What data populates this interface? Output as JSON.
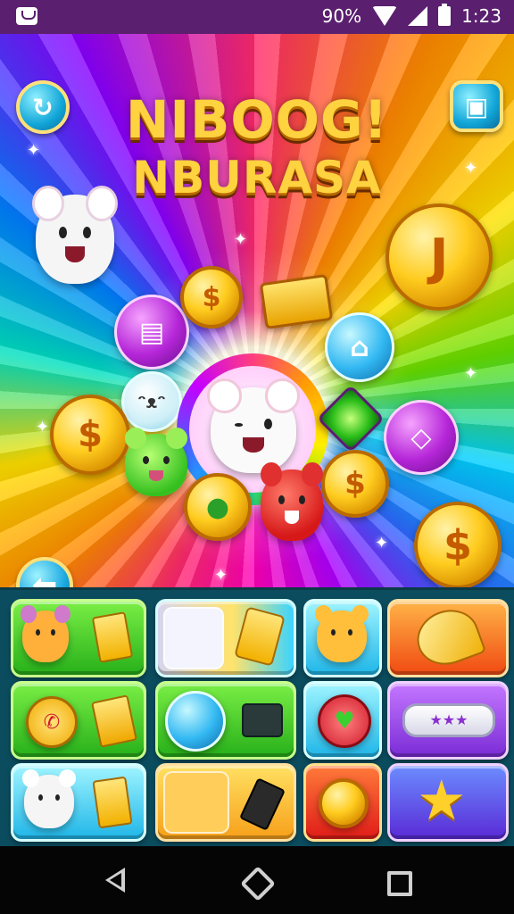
{
  "status_bar": {
    "battery_text": "90%",
    "time": "1:23"
  },
  "game": {
    "title_line1": "NIBOOG!",
    "title_line2": "NBURASA",
    "top_left_button_icon": "refresh-icon",
    "top_right_button_icon": "chat-bubble-icon",
    "back_button_icon": "arrow-left-icon",
    "coin_symbol": "$",
    "special_coin_symbol": "J"
  },
  "bottom_panel": {
    "rows": [
      [
        "green-creature-bar",
        "white-creature-card",
        "orange-creature",
        "orange-sparkle"
      ],
      [
        "green-phone-chair",
        "teal-globe-case",
        "blue-alarm-heart",
        "purple-stars-pill"
      ],
      [
        "blue-white-creature",
        "orange-tiger-card",
        "red-gold-coin",
        "purple-star"
      ]
    ]
  },
  "nav_bar": {
    "back_icon": "back-triangle-icon",
    "home_icon": "home-icon",
    "recents_icon": "recents-square-icon"
  }
}
